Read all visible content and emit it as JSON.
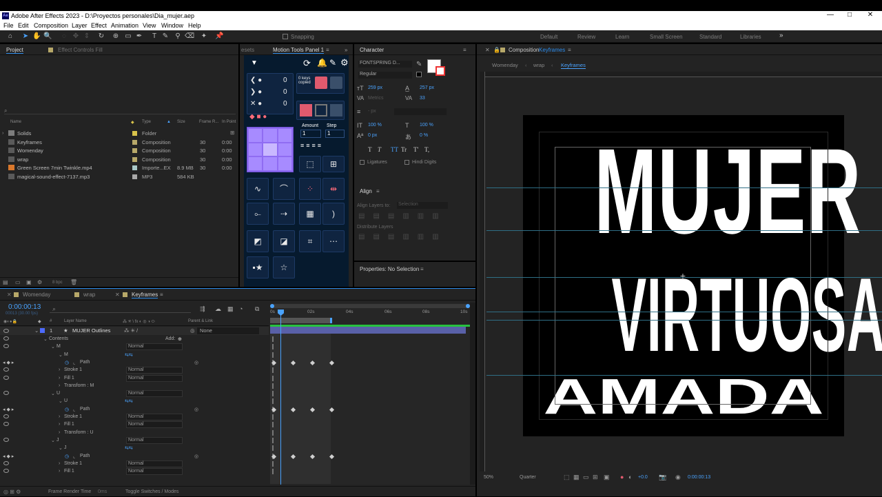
{
  "app": {
    "title": "Adobe After Effects 2023 - D:\\Proyectos personales\\Dia_mujer.aep",
    "logo": "Ae"
  },
  "menu": [
    "File",
    "Edit",
    "Composition",
    "Layer",
    "Effect",
    "Animation",
    "View",
    "Window",
    "Help"
  ],
  "toolbar": {
    "snapping": "Snapping",
    "workspaces": [
      "Default",
      "Review",
      "Learn",
      "Small Screen",
      "Standard",
      "Libraries"
    ],
    "more": "»"
  },
  "project": {
    "tab_project": "Project",
    "tab_effects": "Effect Controls Fill",
    "search_placeholder": "",
    "columns": [
      "Name",
      "Type",
      "Size",
      "Frame R...",
      "In Point"
    ],
    "items": [
      {
        "name": "Solids",
        "type": "Folder",
        "size": "",
        "fr": "",
        "in": "",
        "color": "#d8c24a",
        "icon": "folder-icon"
      },
      {
        "name": "Keyframes",
        "type": "Composition",
        "size": "",
        "fr": "30",
        "in": "0:00",
        "color": "#b7a869",
        "icon": "composition-icon"
      },
      {
        "name": "Womenday",
        "type": "Composition",
        "size": "",
        "fr": "30",
        "in": "0:00",
        "color": "#b7a869",
        "icon": "composition-icon"
      },
      {
        "name": "wrap",
        "type": "Composition",
        "size": "",
        "fr": "30",
        "in": "0:00",
        "color": "#b7a869",
        "icon": "composition-icon"
      },
      {
        "name": "Green Screen 7min Twinkle.mp4",
        "type": "Importe...EX",
        "size": "8.9 MB",
        "fr": "30",
        "in": "0:00",
        "color": "#a9c8c8",
        "icon": "video-file-icon"
      },
      {
        "name": "magical-sound-effect-7137.mp3",
        "type": "MP3",
        "size": "584 KB",
        "fr": "",
        "in": "",
        "color": "#a9a9a9",
        "icon": "audio-file-icon"
      }
    ],
    "bpc": "8 bpc"
  },
  "motion_tools": {
    "tab_prev": "esets",
    "tab": "Motion Tools Panel 1",
    "counters": [
      "0",
      "0",
      "0"
    ],
    "keys_copied": "0 keys\ncopied",
    "amount_label": "Amount",
    "step_label": "Step",
    "amount_value": "1",
    "step_value": "1"
  },
  "character": {
    "tab": "Character",
    "font": "FONTSPRING D...",
    "style": "Regular",
    "size": "259 px",
    "leading": "257 px",
    "kerning": "Metrics",
    "tracking": "33",
    "stroke_width": "- px",
    "vscale": "100 %",
    "hscale": "100 %",
    "baseline": "0 px",
    "tsume": "0 %",
    "styles": [
      "T",
      "T",
      "TT",
      "Tr",
      "T'",
      "T,"
    ],
    "ligatures": "Ligatures",
    "hindi": "Hindi Digits"
  },
  "align": {
    "tab": "Align",
    "align_to_label": "Align Layers to:",
    "align_to_value": "Selection",
    "distribute": "Distribute Layers"
  },
  "properties": {
    "tab": "Properties: No Selection"
  },
  "composition": {
    "tab_label": "Composition",
    "tab_name": "Keyframes",
    "breadcrumbs": [
      "Womenday",
      "wrap",
      "Keyframes"
    ],
    "words": [
      "MUJER",
      "VIRTUOSA",
      "AMADA"
    ],
    "zoom": "50%",
    "quality": "Quarter",
    "exposure": "+0.0",
    "timecode": "0:00:00:13"
  },
  "timeline": {
    "tabs": [
      "Womenday",
      "wrap",
      "Keyframes"
    ],
    "timecode": "0:00:00:13",
    "fps": "00013 (30.00 fps)",
    "columns": {
      "label": "#",
      "layer_name": "Layer Name",
      "parent": "Parent & Link"
    },
    "ruler": [
      "0s",
      "02s",
      "04s",
      "06s",
      "08s",
      "10s"
    ],
    "layer": {
      "index": "1",
      "name": "MUJER Outlines",
      "parent": "None"
    },
    "rows": [
      {
        "indent": 1,
        "label": "Contents",
        "mode": "",
        "extra": "Add:",
        "keys": false
      },
      {
        "indent": 2,
        "label": "M",
        "mode": "Normal",
        "keys": false
      },
      {
        "indent": 3,
        "label": "M",
        "mode": "",
        "keys": false,
        "link": true
      },
      {
        "indent": 4,
        "label": "Path",
        "mode": "",
        "keys": true,
        "stopwatch": true
      },
      {
        "indent": 3,
        "label": "Stroke 1",
        "mode": "Normal",
        "keys": false
      },
      {
        "indent": 3,
        "label": "Fill 1",
        "mode": "Normal",
        "keys": false
      },
      {
        "indent": 3,
        "label": "Transform : M",
        "mode": "",
        "keys": false
      },
      {
        "indent": 2,
        "label": "U",
        "mode": "Normal",
        "keys": false
      },
      {
        "indent": 3,
        "label": "U",
        "mode": "",
        "keys": false,
        "link": true
      },
      {
        "indent": 4,
        "label": "Path",
        "mode": "",
        "keys": true,
        "stopwatch": true
      },
      {
        "indent": 3,
        "label": "Stroke 1",
        "mode": "Normal",
        "keys": false
      },
      {
        "indent": 3,
        "label": "Fill 1",
        "mode": "Normal",
        "keys": false
      },
      {
        "indent": 3,
        "label": "Transform : U",
        "mode": "",
        "keys": false
      },
      {
        "indent": 2,
        "label": "J",
        "mode": "Normal",
        "keys": false
      },
      {
        "indent": 3,
        "label": "J",
        "mode": "",
        "keys": false,
        "link": true
      },
      {
        "indent": 4,
        "label": "Path",
        "mode": "",
        "keys": true,
        "stopwatch": true
      },
      {
        "indent": 3,
        "label": "Stroke 1",
        "mode": "Normal",
        "keys": false
      },
      {
        "indent": 3,
        "label": "Fill 1",
        "mode": "Normal",
        "keys": false
      }
    ],
    "footer_left": "Frame Render Time",
    "footer_ms": "0ms",
    "footer_toggle": "Toggle Switches / Modes"
  }
}
